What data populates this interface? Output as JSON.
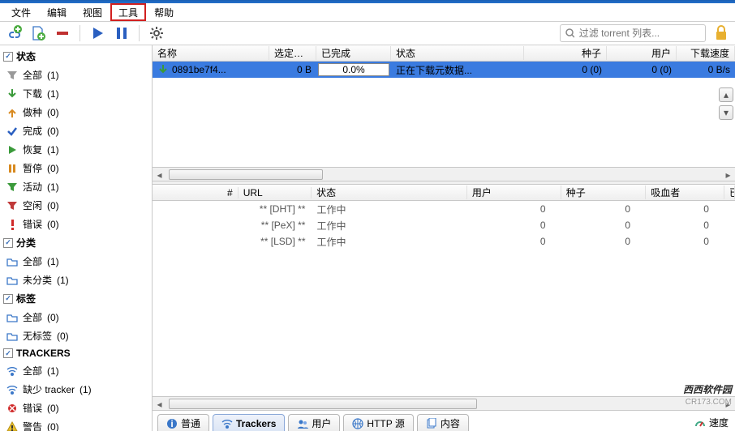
{
  "menu": {
    "file": "文件",
    "edit": "编辑",
    "view": "视图",
    "tools": "工具",
    "help": "帮助",
    "highlighted": "tools"
  },
  "toolbar": {
    "icons": {
      "add_link": "add-link-icon",
      "add_file": "add-file-icon",
      "remove": "remove-icon",
      "start": "start-icon",
      "pause": "pause-icon",
      "settings": "gear-icon"
    },
    "search_placeholder": "过滤 torrent 列表...",
    "lock_icon": "lock-icon"
  },
  "sidebar": {
    "status": {
      "header": "状态",
      "items": [
        {
          "icon": "filter-gray",
          "label": "全部",
          "count": "(1)"
        },
        {
          "icon": "arrow-down-green",
          "label": "下载",
          "count": "(1)"
        },
        {
          "icon": "arrow-up-orange",
          "label": "做种",
          "count": "(0)"
        },
        {
          "icon": "check-blue",
          "label": "完成",
          "count": "(0)"
        },
        {
          "icon": "play-green",
          "label": "恢复",
          "count": "(1)"
        },
        {
          "icon": "pause-orange",
          "label": "暂停",
          "count": "(0)"
        },
        {
          "icon": "filter-green",
          "label": "活动",
          "count": "(1)"
        },
        {
          "icon": "filter-red",
          "label": "空闲",
          "count": "(0)"
        },
        {
          "icon": "exclaim-red",
          "label": "错误",
          "count": "(0)"
        }
      ]
    },
    "category": {
      "header": "分类",
      "items": [
        {
          "icon": "folder-blue",
          "label": "全部",
          "count": "(1)"
        },
        {
          "icon": "folder-blue",
          "label": "未分类",
          "count": "(1)"
        }
      ]
    },
    "tags": {
      "header": "标签",
      "items": [
        {
          "icon": "folder-blue",
          "label": "全部",
          "count": "(0)"
        },
        {
          "icon": "folder-blue",
          "label": "无标签",
          "count": "(0)"
        }
      ]
    },
    "trackers": {
      "header": "TRACKERS",
      "items": [
        {
          "icon": "tracker-blue",
          "label": "全部",
          "count": "(1)"
        },
        {
          "icon": "tracker-blue",
          "label": "缺少 tracker",
          "count": "(1)"
        },
        {
          "icon": "circle-red",
          "label": "错误",
          "count": "(0)"
        },
        {
          "icon": "warn-yellow",
          "label": "警告",
          "count": "(0)"
        }
      ]
    }
  },
  "torrent_columns": {
    "name": "名称",
    "size": "选定大小",
    "done": "已完成",
    "status": "状态",
    "seeds": "种子",
    "peers": "用户",
    "speed": "下载速度"
  },
  "torrents": [
    {
      "icon": "arrow-down-green",
      "name": "0891be7f4...",
      "size": "0 B",
      "done": "0.0%",
      "status": "正在下载元数据...",
      "seeds": "0 (0)",
      "peers": "0 (0)",
      "speed": "0 B/s",
      "selected": true
    }
  ],
  "tracker_columns": {
    "num": "#",
    "url": "URL",
    "status": "状态",
    "peers": "用户",
    "seeds": "种子",
    "leeches": "吸血者",
    "downloaded": "已下"
  },
  "trackers": [
    {
      "num": "",
      "url": "** [DHT] **",
      "status": "工作中",
      "peers": "0",
      "seeds": "0",
      "leeches": "0",
      "dl": ""
    },
    {
      "num": "",
      "url": "** [PeX] **",
      "status": "工作中",
      "peers": "0",
      "seeds": "0",
      "leeches": "0",
      "dl": ""
    },
    {
      "num": "",
      "url": "** [LSD] **",
      "status": "工作中",
      "peers": "0",
      "seeds": "0",
      "leeches": "0",
      "dl": ""
    }
  ],
  "tabs": [
    {
      "icon": "info-icon",
      "label": "普通",
      "active": false
    },
    {
      "icon": "tracker-blue",
      "label": "Trackers",
      "active": true
    },
    {
      "icon": "users-icon",
      "label": "用户",
      "active": false
    },
    {
      "icon": "http-icon",
      "label": "HTTP 源",
      "active": false
    },
    {
      "icon": "files-icon",
      "label": "内容",
      "active": false
    }
  ],
  "statusbar": {
    "speed_label": "速度"
  },
  "watermark": {
    "brand": "西西软件园",
    "url": "CR173.COM"
  }
}
